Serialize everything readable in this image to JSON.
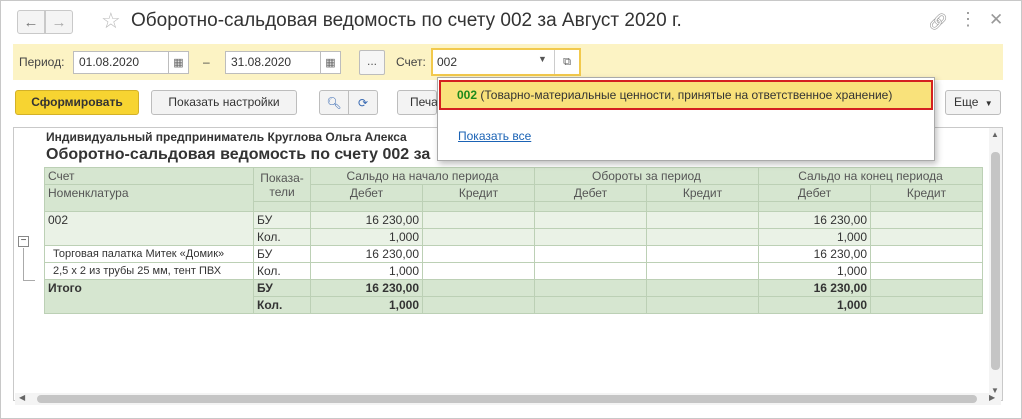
{
  "window": {
    "title": "Оборотно-сальдовая ведомость по счету 002 за Август 2020 г.",
    "icons": [
      "back-arrow",
      "forward-arrow",
      "star",
      "link-icon",
      "more-icon",
      "close-icon"
    ]
  },
  "filters": {
    "period_label": "Период:",
    "date_from": "01.08.2020",
    "dash": "–",
    "date_to": "31.08.2020",
    "dots_label": "...",
    "account_label": "Счет:",
    "account_value": "002"
  },
  "toolbar": {
    "generate": "Сформировать",
    "show_settings": "Показать настройки",
    "print": "Печа",
    "more": "Еще"
  },
  "report": {
    "line1": "Индивидуальный предприниматель Круглова Ольга Алекса",
    "line2": "Оборотно-сальдовая ведомость по счету 002 за",
    "headers": {
      "account": "Счет",
      "nomenclature": "Номенклатура",
      "indicators": "Показа-\nтели",
      "opening_balance": "Сальдо на начало периода",
      "turnover": "Обороты за период",
      "closing_balance": "Сальдо на конец периода",
      "debit": "Дебет",
      "credit": "Кредит"
    },
    "rows": [
      {
        "name": "002",
        "ind": "БУ",
        "open_debit": "16 230,00",
        "open_credit": "",
        "turn_debit": "",
        "turn_credit": "",
        "close_debit": "16 230,00",
        "close_credit": ""
      },
      {
        "name": "",
        "ind": "Кол.",
        "open_debit": "1,000",
        "open_credit": "",
        "turn_debit": "",
        "turn_credit": "",
        "close_debit": "1,000",
        "close_credit": ""
      },
      {
        "name": "Торговая палатка Митек «Домик»",
        "ind": "БУ",
        "open_debit": "16 230,00",
        "open_credit": "",
        "turn_debit": "",
        "turn_credit": "",
        "close_debit": "16 230,00",
        "close_credit": ""
      },
      {
        "name": "2,5 х 2 из трубы 25 мм, тент ПВХ",
        "ind": "Кол.",
        "open_debit": "1,000",
        "open_credit": "",
        "turn_debit": "",
        "turn_credit": "",
        "close_debit": "1,000",
        "close_credit": ""
      },
      {
        "name": "Итого",
        "ind": "БУ",
        "open_debit": "16 230,00",
        "open_credit": "",
        "turn_debit": "",
        "turn_credit": "",
        "close_debit": "16 230,00",
        "close_credit": ""
      },
      {
        "name": "",
        "ind": "Кол.",
        "open_debit": "1,000",
        "open_credit": "",
        "turn_debit": "",
        "turn_credit": "",
        "close_debit": "1,000",
        "close_credit": ""
      }
    ]
  },
  "dropdown": {
    "item_code": "002",
    "item_text": "(Товарно-материальные ценности, принятые на ответственное хранение)",
    "show_all": "Показать все"
  }
}
